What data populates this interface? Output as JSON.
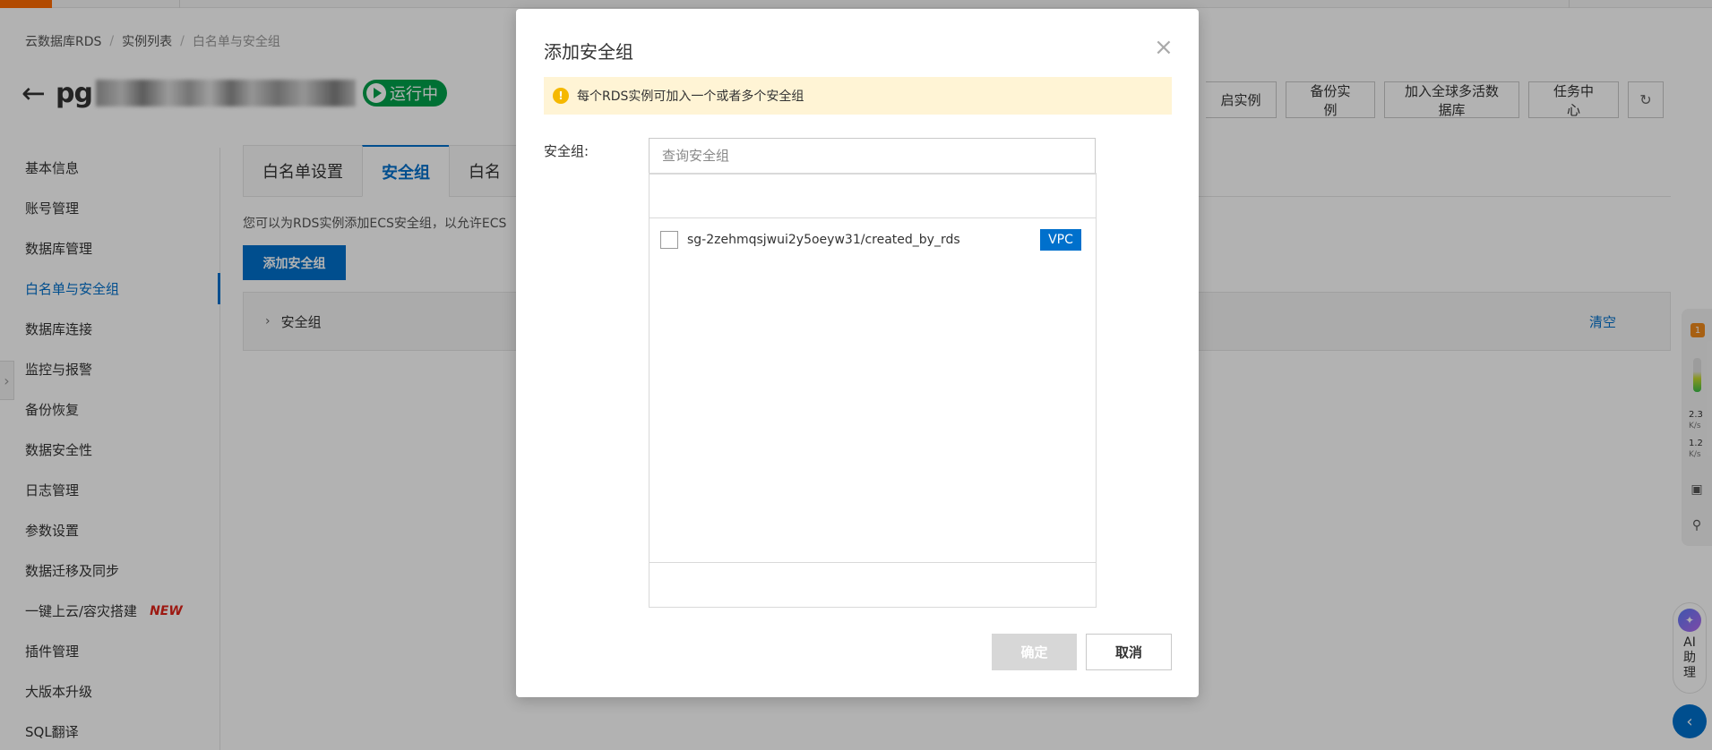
{
  "breadcrumb": [
    "云数据库RDS",
    "实例列表",
    "白名单与安全组"
  ],
  "page": {
    "title_prefix": "pg",
    "status": "运行中"
  },
  "actions": [
    "启实例",
    "备份实例",
    "加入全球多活数据库",
    "任务中心"
  ],
  "sidebar": {
    "items": [
      {
        "label": "基本信息"
      },
      {
        "label": "账号管理"
      },
      {
        "label": "数据库管理"
      },
      {
        "label": "白名单与安全组",
        "active": true
      },
      {
        "label": "数据库连接"
      },
      {
        "label": "监控与报警"
      },
      {
        "label": "备份恢复"
      },
      {
        "label": "数据安全性"
      },
      {
        "label": "日志管理"
      },
      {
        "label": "参数设置"
      },
      {
        "label": "数据迁移及同步"
      },
      {
        "label": "一键上云/容灾搭建",
        "tag": "NEW"
      },
      {
        "label": "插件管理"
      },
      {
        "label": "大版本升级"
      },
      {
        "label": "SQL翻译"
      }
    ]
  },
  "tabs": [
    "白名单设置",
    "安全组",
    "白名"
  ],
  "main": {
    "description": "您可以为RDS实例添加ECS安全组，以允许ECS",
    "add_button": "添加安全组",
    "panel_label": "安全组",
    "clear_label": "清空"
  },
  "right_widget": {
    "badge": "1",
    "upload_speed": "2.3",
    "download_speed": "1.2",
    "speed_unit": "K/s"
  },
  "ai_helper": {
    "label": "AI助理"
  },
  "modal": {
    "title": "添加安全组",
    "notice": "每个RDS实例可加入一个或者多个安全组",
    "field_label": "安全组:",
    "search_placeholder": "查询安全组",
    "security_groups": [
      {
        "name": "sg-2zehmqsjwui2y5oeyw31/created_by_rds",
        "tag": "VPC",
        "checked": false
      }
    ],
    "ok_label": "确定",
    "cancel_label": "取消"
  },
  "colors": {
    "primary": "#0070cc",
    "status_green": "#00a14b",
    "notice_bg": "#fff4d5",
    "warning_icon": "#f5b800",
    "new_tag": "#e1251b",
    "brand_orange": "#ff6a00"
  }
}
